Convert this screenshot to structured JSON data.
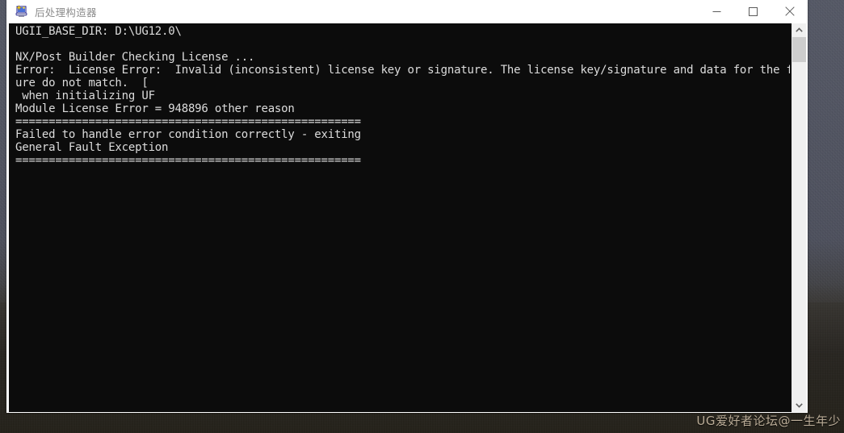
{
  "window": {
    "title": "后处理构造器",
    "icon": "post-builder-app-icon",
    "controls": [
      {
        "name": "minimize",
        "glyph": "minimize-icon"
      },
      {
        "name": "maximize",
        "glyph": "maximize-icon"
      },
      {
        "name": "close",
        "glyph": "close-icon"
      }
    ]
  },
  "console": {
    "lines": [
      "UGII_BASE_DIR: D:\\UG12.0\\",
      "",
      "NX/Post Builder Checking License ...",
      "Error:  License Error:  Invalid (inconsistent) license key or signature. The license key/signature and data for the feat",
      "ure do not match.  [",
      " when initializing UF",
      "Module License Error = 948896 other reason",
      "====================================================",
      "Failed to handle error condition correctly - exiting",
      "General Fault Exception",
      "===================================================="
    ],
    "background_color": "#0c0c0c",
    "text_color": "#dcdcdc"
  },
  "scrollbar": {
    "up_arrow": "chevron-up-icon",
    "down_arrow": "chevron-down-icon",
    "thumb_label": "scroll-thumb"
  },
  "watermark": {
    "text": "UG爱好者论坛@一生年少"
  }
}
